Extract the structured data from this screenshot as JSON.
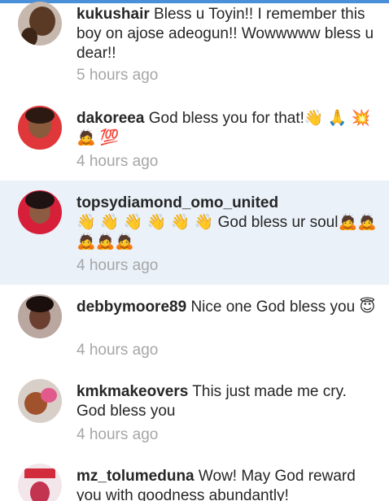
{
  "comments": [
    {
      "user": "kukushair",
      "body": "Bless u Toyin!! I remember this boy on ajose adeogun!! Wowwwww bless u dear!!",
      "time": "5 hours ago",
      "highlighted": false
    },
    {
      "user": "dakoreea",
      "body": "God bless you for that!👋 🙏 💥 🙇 💯",
      "time": "4 hours ago",
      "highlighted": false
    },
    {
      "user": "topsydiamond_omo_united",
      "body": "👋 👋 👋 👋 👋 👋   God bless ur soul🙇🙇🙇🙇🙇",
      "time": "4 hours ago",
      "highlighted": true
    },
    {
      "user": "debbymoore89",
      "body": "Nice one God bless you 😇",
      "time": "4 hours ago",
      "highlighted": false
    },
    {
      "user": "kmkmakeovers",
      "body": "This just made me cry. God bless you",
      "time": "4 hours ago",
      "highlighted": false
    },
    {
      "user": "mz_tolumeduna",
      "body": "Wow! May God reward you with goodness abundantly!",
      "time": "",
      "highlighted": false
    }
  ],
  "colors": {
    "accent": "#4a90d9",
    "highlight_bg": "#eaf1f9",
    "timestamp": "#a6a6a6",
    "text": "#262626"
  }
}
